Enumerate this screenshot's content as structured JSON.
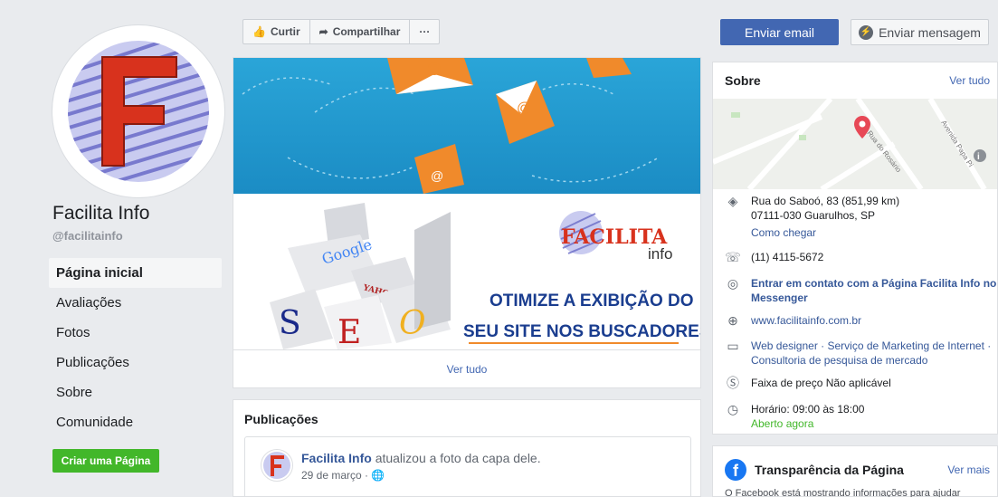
{
  "page": {
    "name": "Facilita Info",
    "handle": "@facilitainfo"
  },
  "sidebar": {
    "items": [
      {
        "label": "Página inicial",
        "active": true
      },
      {
        "label": "Avaliações"
      },
      {
        "label": "Fotos"
      },
      {
        "label": "Publicações"
      },
      {
        "label": "Sobre"
      },
      {
        "label": "Comunidade"
      }
    ],
    "create_button": "Criar uma Página"
  },
  "actions": {
    "like": "Curtir",
    "share": "Compartilhar",
    "more": "···",
    "email": "Enviar email",
    "message": "Enviar mensagem"
  },
  "cover": {
    "logo_text": "FACILITA",
    "logo_sub": "info",
    "headline_1": "OTIMIZE A EXIBIÇÃO DO",
    "headline_2": "SEU SITE NOS BUSCADORES",
    "seo_letters": [
      "S",
      "E",
      "O"
    ],
    "box_labels": [
      "Google",
      "YAHOO!"
    ],
    "see_all": "Ver tudo"
  },
  "posts": {
    "title": "Publicações",
    "author": "Facilita Info",
    "action": "atualizou a foto da capa dele.",
    "date": "29 de março ·"
  },
  "about": {
    "title": "Sobre",
    "see_all": "Ver tudo",
    "map_streets": [
      "Rua do Rosário",
      "Avenida Papa Pi"
    ],
    "address_line1": "Rua do Saboó, 83 (851,99 km)",
    "address_line2": "07111-030 Guarulhos, SP",
    "directions": "Como chegar",
    "phone": "(11) 4115-5672",
    "messenger_1": "Entrar em contato com a Página Facilita Info no",
    "messenger_2": "Messenger",
    "website": "www.facilitainfo.com.br",
    "categories_1": "Web designer · Serviço de Marketing de Internet ·",
    "categories_2": "Consultoria de pesquisa de mercado",
    "price": "Faixa de preço Não aplicável",
    "hours": "Horário: 09:00 às 18:00",
    "open_now": "Aberto agora"
  },
  "transparency": {
    "title": "Transparência da Página",
    "see_more": "Ver mais",
    "text": "O Facebook está mostrando informações para ajudar"
  },
  "colors": {
    "primary": "#4267b2",
    "green": "#42b72a",
    "background": "#e9ebee",
    "logo_red": "#d8321d"
  }
}
